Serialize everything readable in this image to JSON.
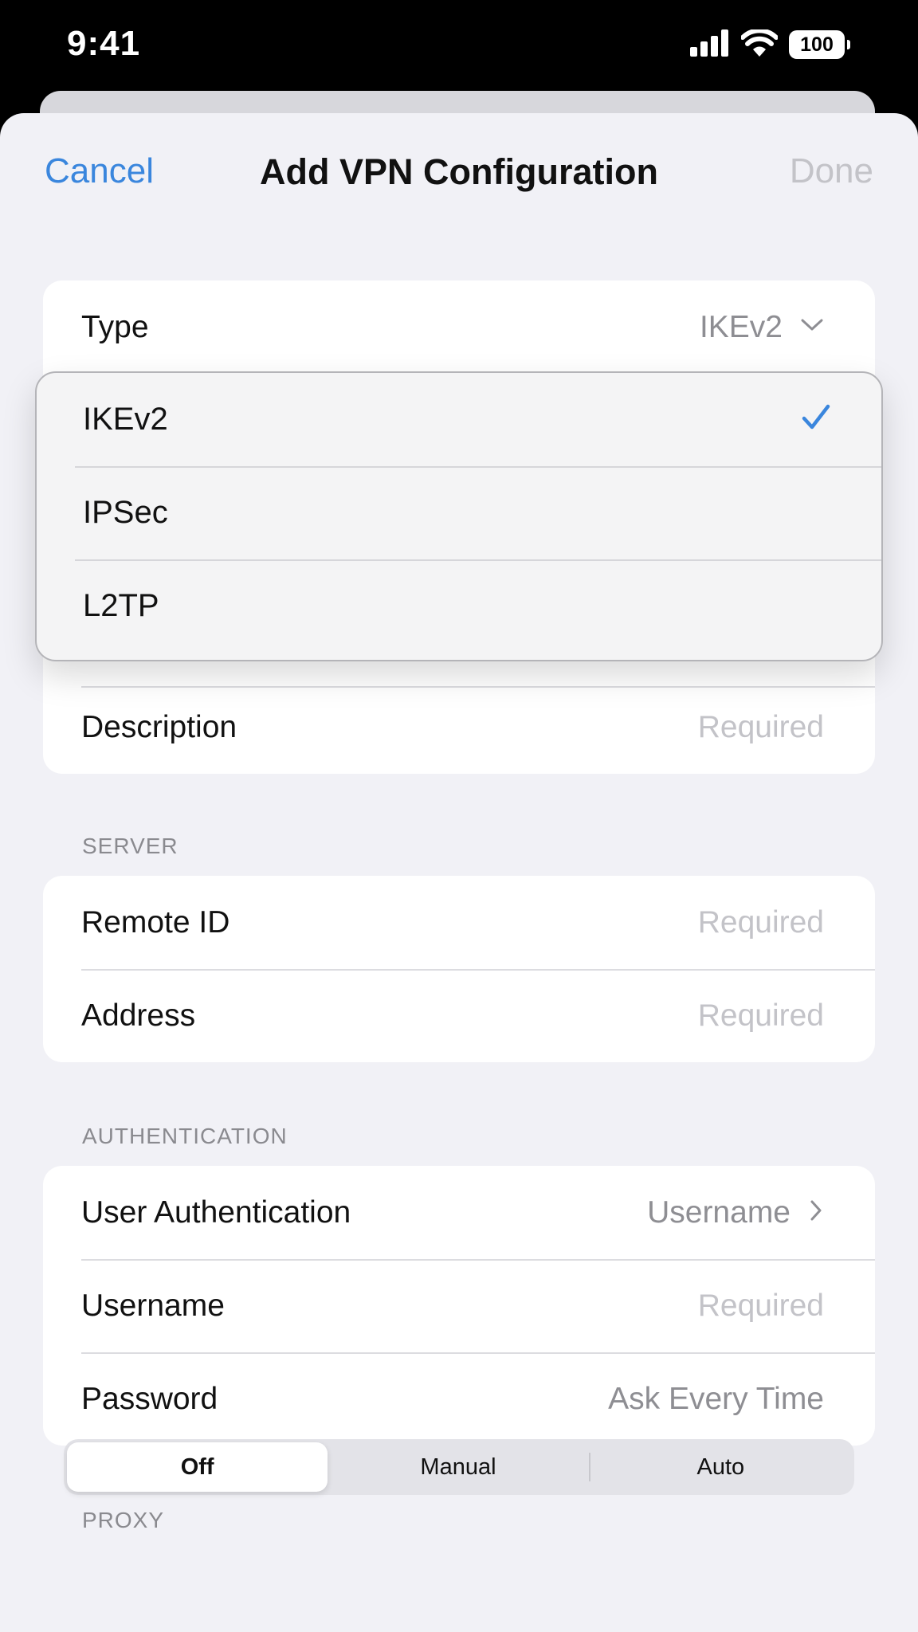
{
  "status_bar": {
    "time": "9:41",
    "battery": "100",
    "icons": [
      "cellular-signal-icon",
      "wifi-icon",
      "battery-icon"
    ]
  },
  "nav": {
    "cancel": "Cancel",
    "title": "Add VPN Configuration",
    "done": "Done"
  },
  "type_row": {
    "label": "Type",
    "value": "IKEv2"
  },
  "type_menu": {
    "options": [
      {
        "label": "IKEv2",
        "selected": true
      },
      {
        "label": "IPSec",
        "selected": false
      },
      {
        "label": "L2TP",
        "selected": false
      }
    ]
  },
  "description_row": {
    "label": "Description",
    "placeholder": "Required"
  },
  "server": {
    "header": "SERVER",
    "rows": [
      {
        "label": "Remote ID",
        "placeholder": "Required"
      },
      {
        "label": "Address",
        "placeholder": "Required"
      }
    ]
  },
  "authentication": {
    "header": "AUTHENTICATION",
    "user_auth": {
      "label": "User Authentication",
      "value": "Username"
    },
    "username": {
      "label": "Username",
      "placeholder": "Required"
    },
    "password": {
      "label": "Password",
      "value": "Ask Every Time"
    }
  },
  "proxy": {
    "header": "PROXY",
    "options": [
      "Off",
      "Manual",
      "Auto"
    ],
    "selected": "Off"
  },
  "colors": {
    "accent": "#3a86dd",
    "placeholder": "#c3c3c8",
    "secondary_text": "#8e8e93",
    "background": "#f1f1f6"
  }
}
